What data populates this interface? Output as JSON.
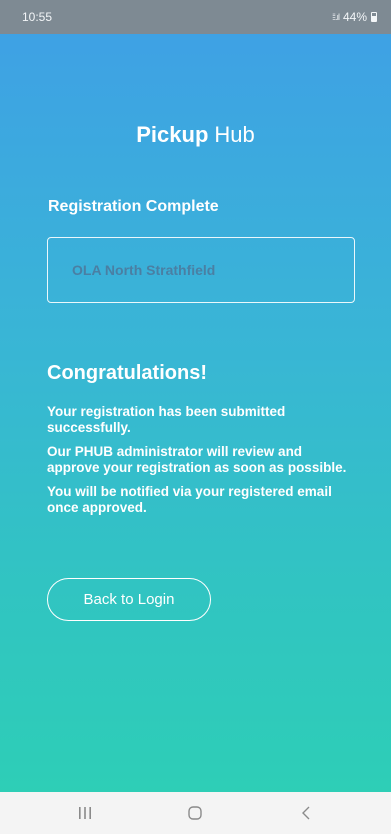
{
  "status_bar": {
    "time": "10:55",
    "signal_text": "⁞⁞.ıl",
    "battery": "44%"
  },
  "header": {
    "title_bold": "Pickup",
    "title_light": "Hub"
  },
  "registration": {
    "heading": "Registration Complete",
    "school_name": "OLA North Strathfield"
  },
  "confirmation": {
    "title": "Congratulations!",
    "messages": [
      "Your registration has been submitted successfully.",
      "Our PHUB administrator will review and approve your registration as soon as possible.",
      "You will be notified via your registered email once approved."
    ],
    "back_button_label": "Back to Login"
  },
  "nav_bar": {
    "icons": [
      "recent-apps-icon",
      "home-icon",
      "back-icon"
    ]
  },
  "colors": {
    "gradient_top": "#3f9fe6",
    "gradient_bottom": "#2dd0b4",
    "status_bar": "#7e8a93",
    "school_text": "#4a7fa3"
  }
}
